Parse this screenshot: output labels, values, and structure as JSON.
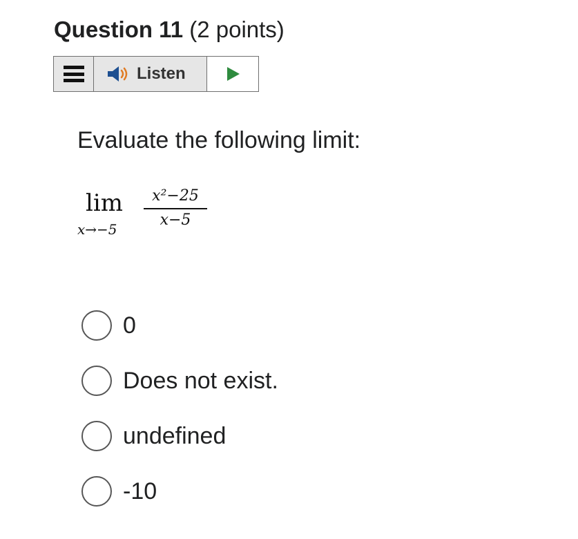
{
  "question": {
    "title": "Question 11",
    "points": " (2 points)"
  },
  "toolbar": {
    "listen_label": "Listen",
    "menu_icon": "hamburger-menu-icon",
    "speaker_icon": "speaker-icon",
    "play_icon": "play-icon",
    "speaker_color": "#1d4f91",
    "wave_color": "#e07b23",
    "play_color": "#2e8b3e"
  },
  "prompt": "Evaluate the following limit:",
  "math": {
    "lim": "lim",
    "subscript": "x→−5",
    "numerator": "x²−25",
    "denominator": "x−5"
  },
  "options": [
    {
      "label": "0",
      "selected": false
    },
    {
      "label": "Does not exist.",
      "selected": false
    },
    {
      "label": "undefined",
      "selected": false
    },
    {
      "label": "-10",
      "selected": false
    }
  ]
}
